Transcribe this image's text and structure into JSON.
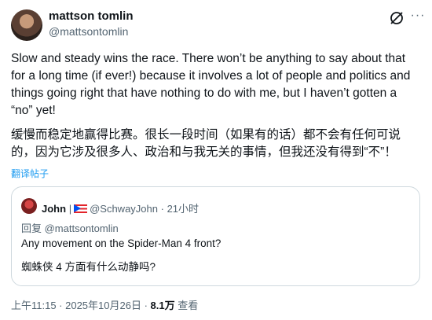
{
  "author": {
    "name": "mattson tomlin",
    "handle": "@mattsontomlin"
  },
  "post": {
    "text_en": "Slow and steady wins the race. There won’t  be anything to say about that for a long time (if ever!) because it involves a lot of people and politics and things going right that have nothing to do with me, but I haven’t gotten a “no” yet!",
    "text_zh": "缓慢而稳定地赢得比赛。很长一段时间（如果有的话）都不会有任何可说的，因为它涉及很多人、政治和与我无关的事情，但我还没有得到“不”！",
    "translate_label": "翻译帖子"
  },
  "quote": {
    "name": "John",
    "separator": "|",
    "handle": "@SchwayJohn",
    "dot": "·",
    "time": "21小时",
    "reply_to": "回复 @mattsontomlin",
    "text_en": "Any movement on the Spider-Man 4 front?",
    "text_zh": "蜘蛛侠 4 方面有什么动静吗?"
  },
  "meta": {
    "time": "上午11:15 · 2025年10月26日 ·",
    "views_count": "8.1万",
    "views_label": "查看"
  },
  "icons": {
    "grok": "grok-icon",
    "more": "more-icon"
  }
}
